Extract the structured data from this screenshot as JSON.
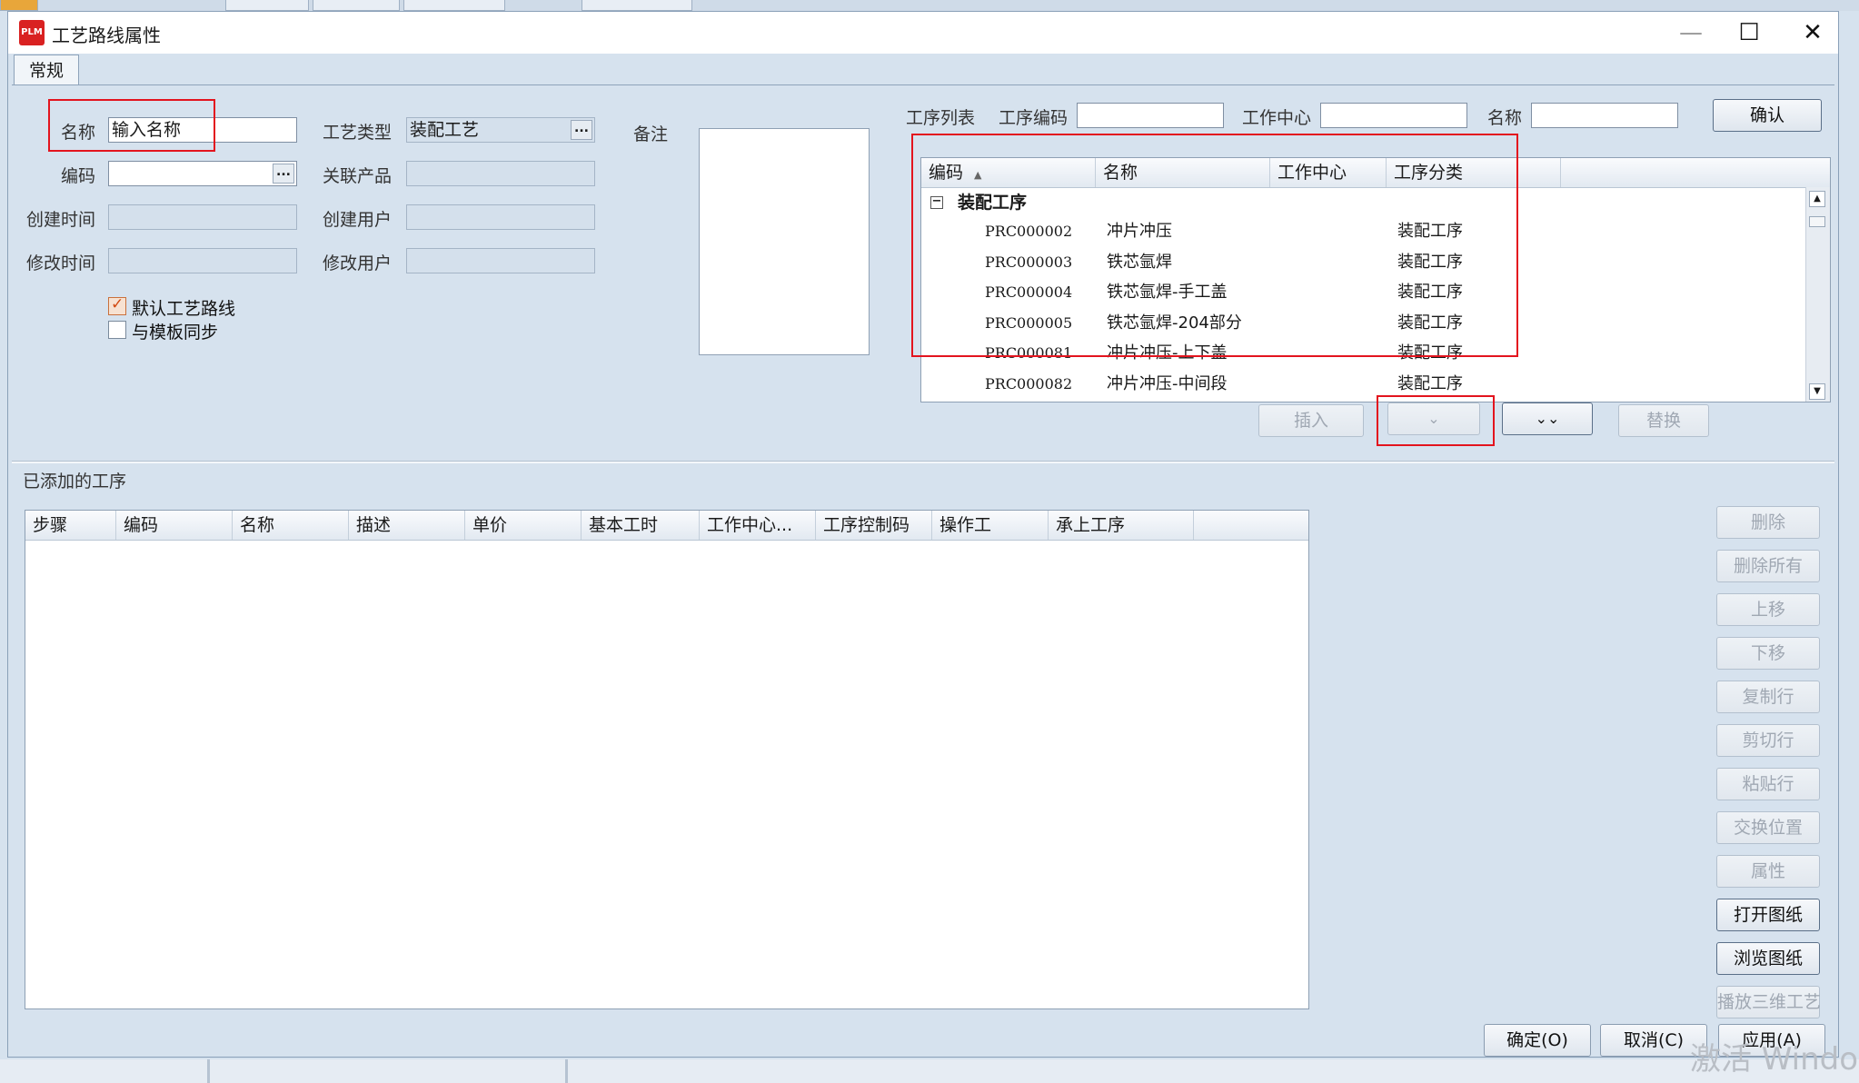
{
  "dialog": {
    "logo_text": "PLM",
    "title": "工艺路线属性",
    "minimize": "—",
    "maximize": "☐",
    "close": "✕"
  },
  "tabs": [
    {
      "label": "常规"
    }
  ],
  "form": {
    "name_label": "名称",
    "name_value": "输入名称",
    "code_label": "编码",
    "code_value": "",
    "created_time_label": "创建时间",
    "modified_time_label": "修改时间",
    "process_type_label": "工艺类型",
    "process_type_value": "装配工艺",
    "related_product_label": "关联产品",
    "created_user_label": "创建用户",
    "modified_user_label": "修改用户",
    "remark_label": "备注",
    "ellipsis": "...",
    "default_route_label": "默认工艺路线",
    "default_route_checked": true,
    "sync_template_label": "与模板同步",
    "sync_template_checked": false
  },
  "process_search": {
    "list_label": "工序列表",
    "code_label": "工序编码",
    "work_center_label": "工作中心",
    "name_label": "名称",
    "confirm_button": "确认"
  },
  "process_table": {
    "headers": [
      "编码",
      "名称",
      "工作中心",
      "工序分类"
    ],
    "sort_indicator": "▲",
    "group": {
      "toggle": "−",
      "name": "装配工序"
    },
    "rows": [
      {
        "code": "PRC000002",
        "name": "冲片冲压",
        "work_center": "",
        "category": "装配工序"
      },
      {
        "code": "PRC000003",
        "name": "铁芯氩焊",
        "work_center": "",
        "category": "装配工序"
      },
      {
        "code": "PRC000004",
        "name": "铁芯氩焊-手工盖",
        "work_center": "",
        "category": "装配工序"
      },
      {
        "code": "PRC000005",
        "name": "铁芯氩焊-204部分",
        "work_center": "",
        "category": "装配工序"
      },
      {
        "code": "PRC000081",
        "name": "冲片冲压-上下盖",
        "work_center": "",
        "category": "装配工序"
      },
      {
        "code": "PRC000082",
        "name": "冲片冲压-中间段",
        "work_center": "",
        "category": "装配工序"
      }
    ],
    "scroll_up": "▲",
    "scroll_down": "▼"
  },
  "process_actions": {
    "insert": "插入",
    "add_one": "⌄",
    "add_all": "⌄⌄",
    "replace": "替换"
  },
  "added": {
    "section_label": "已添加的工序",
    "headers": [
      "步骤",
      "编码",
      "名称",
      "描述",
      "单价",
      "基本工时",
      "工作中心...",
      "工序控制码",
      "操作工",
      "承上工序"
    ]
  },
  "side_buttons": [
    {
      "label": "删除",
      "enabled": false
    },
    {
      "label": "删除所有",
      "enabled": false
    },
    {
      "label": "上移",
      "enabled": false
    },
    {
      "label": "下移",
      "enabled": false
    },
    {
      "label": "复制行",
      "enabled": false
    },
    {
      "label": "剪切行",
      "enabled": false
    },
    {
      "label": "粘贴行",
      "enabled": false
    },
    {
      "label": "交换位置",
      "enabled": false
    },
    {
      "label": "属性",
      "enabled": false
    },
    {
      "label": "打开图纸",
      "enabled": true
    },
    {
      "label": "浏览图纸",
      "enabled": true
    },
    {
      "label": "播放三维工艺",
      "enabled": false
    }
  ],
  "footer": {
    "ok": "确定(O)",
    "cancel": "取消(C)",
    "apply": "应用(A)"
  },
  "watermark": "激活 Windows"
}
